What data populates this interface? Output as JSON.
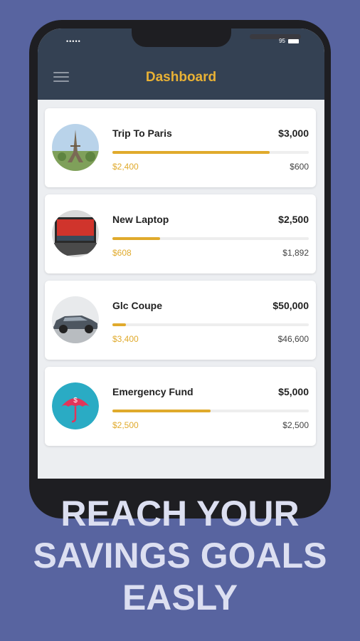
{
  "status": {
    "signal": "•••••",
    "battery": "95"
  },
  "header": {
    "title": "Dashboard"
  },
  "goals": [
    {
      "name": "Trip To Paris",
      "target": "$3,000",
      "saved": "$2,400",
      "remaining": "$600",
      "progress": 0.8,
      "image": "eiffel-tower"
    },
    {
      "name": "New Laptop",
      "target": "$2,500",
      "saved": "$608",
      "remaining": "$1,892",
      "progress": 0.243,
      "image": "laptop"
    },
    {
      "name": "Glc Coupe",
      "target": "$50,000",
      "saved": "$3,400",
      "remaining": "$46,600",
      "progress": 0.068,
      "image": "car"
    },
    {
      "name": "Emergency Fund",
      "target": "$5,000",
      "saved": "$2,500",
      "remaining": "$2,500",
      "progress": 0.5,
      "image": "umbrella-dollar-icon"
    }
  ],
  "headline": [
    "REACH YOUR",
    "SAVINGS GOALS",
    "EASLY"
  ],
  "colors": {
    "accent": "#e0aa2c",
    "header": "#344153",
    "background": "#5864a0"
  }
}
